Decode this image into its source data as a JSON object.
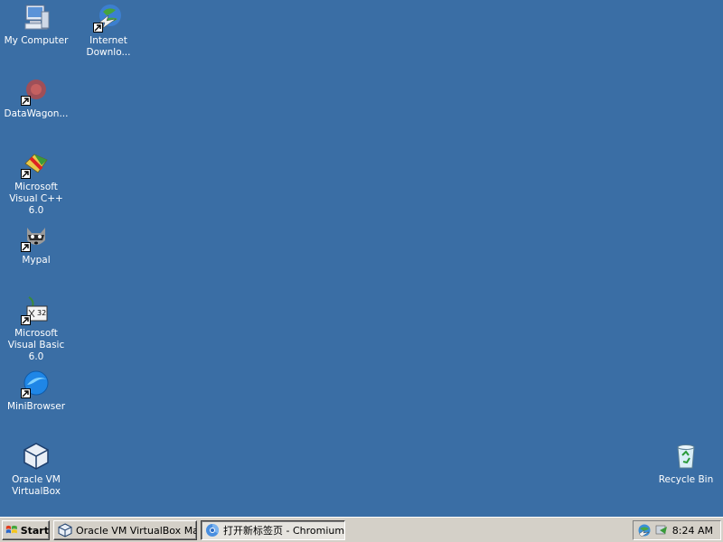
{
  "desktop": {
    "background_color": "#3a6ea5",
    "icons": [
      {
        "label": "My Computer",
        "icon": "my-computer-icon",
        "shortcut": false
      },
      {
        "label": "Internet Downlo...",
        "icon": "internet-download-manager-icon",
        "shortcut": true
      },
      {
        "label": "DataWagon...",
        "icon": "datawagon-icon",
        "shortcut": true
      },
      {
        "label": "Microsoft Visual C++ 6.0",
        "icon": "visual-cpp-icon",
        "shortcut": true
      },
      {
        "label": "Mypal",
        "icon": "mypal-raccoon-icon",
        "shortcut": true
      },
      {
        "label": "Microsoft Visual Basic 6.0",
        "icon": "visual-basic-icon",
        "shortcut": true
      },
      {
        "label": "MiniBrowser",
        "icon": "minibrowser-icon",
        "shortcut": true
      },
      {
        "label": "Oracle VM VirtualBox",
        "icon": "virtualbox-icon",
        "shortcut": false
      },
      {
        "label": "Recycle Bin",
        "icon": "recycle-bin-icon",
        "shortcut": false
      }
    ]
  },
  "taskbar": {
    "start_label": "Start",
    "buttons": [
      {
        "label": "Oracle VM VirtualBox Ma...",
        "icon": "virtualbox-icon",
        "active": false
      },
      {
        "label": "打开新标签页 - Chromium",
        "icon": "chromium-icon",
        "active": true
      }
    ],
    "tray_icons": [
      "network-globe-icon",
      "idm-tray-icon"
    ],
    "clock": "8:24 AM"
  }
}
